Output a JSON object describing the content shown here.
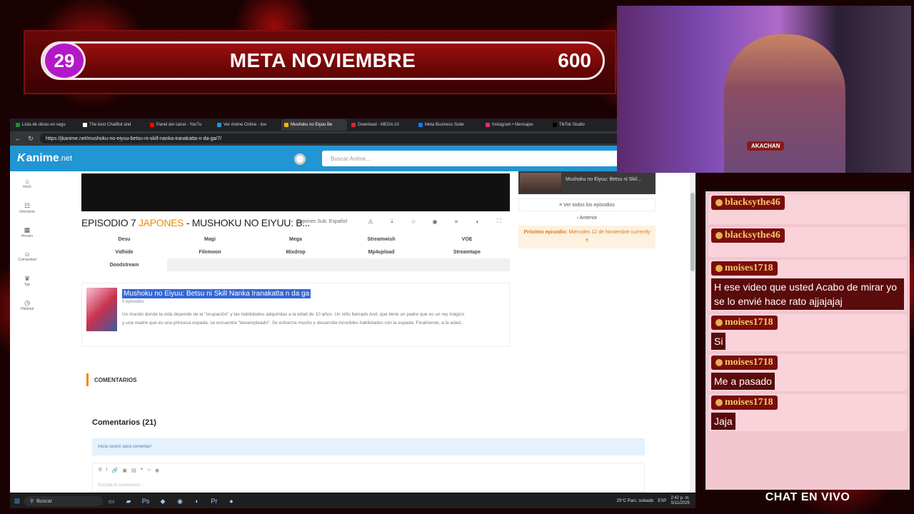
{
  "goal": {
    "current": "29",
    "title": "META NOVIEMBRE",
    "target": "600"
  },
  "browser": {
    "tabs": [
      {
        "label": "Lista de obras en segu",
        "color": "#1e8e3e"
      },
      {
        "label": "The best ChatBot and",
        "color": "#ffffff"
      },
      {
        "label": "Panel del canal - YouTu",
        "color": "#ff0000"
      },
      {
        "label": "Ver Anime Online - too",
        "color": "#2196d3"
      },
      {
        "label": "Mushoku no Eiyuu Be",
        "color": "#f5b400",
        "active": true
      },
      {
        "label": "Download - MEGA 10",
        "color": "#d9272e"
      },
      {
        "label": "Meta Business Suite",
        "color": "#1877f2"
      },
      {
        "label": "Instagram • Mensajes",
        "color": "#e1306c"
      },
      {
        "label": "TikTok Studio",
        "color": "#000000"
      }
    ],
    "url": "https://jkanime.net/mushoku-no-eiyuu-betsu-ni-skill-nanka-iranakatta-n-da-ga/7/"
  },
  "site": {
    "logo_k": "K",
    "logo_text": "anime",
    "logo_tld": ".net",
    "search_placeholder": "Buscar Anime...",
    "sidebar": [
      {
        "icon": "⌂",
        "label": "Inicio"
      },
      {
        "icon": "☷",
        "label": "Directorio"
      },
      {
        "icon": "▦",
        "label": "Horario"
      },
      {
        "icon": "☺",
        "label": "Comunidad"
      },
      {
        "icon": "♛",
        "label": "Top"
      },
      {
        "icon": "◷",
        "label": "Historial"
      }
    ],
    "episode": {
      "prefix": "EPISODIO 7 ",
      "lang": "JAPONES",
      "rest": " - MUSHOKU NO EIYUU: B..."
    },
    "language_select": "Japones Sub. Español",
    "tools": [
      "⚠",
      "⤓",
      "☆",
      "◉",
      "≡",
      "◐",
      "⛶"
    ],
    "servers": [
      [
        "Desu",
        "Magi",
        "Mega",
        "Streamwish",
        "VOE"
      ],
      [
        "Vidhide",
        "Filemoon",
        "Mixdrop",
        "Mp4upload",
        "Streamtape"
      ],
      [
        "Doodstream"
      ]
    ],
    "anime": {
      "name": "Mushoku no Eiyuu: Betsu ni Skill Nanka Iranakatta n da ga",
      "episodes": "0 episodios",
      "description": "Un mundo donde la vida depende de la \"ocupación\" y las habilidades adquiridas a la edad de 10 años. Un niño llamado Arel, que tiene un padre que es un rey mágico y una madre que es una princesa espada, se encuentra \"desempleado\". Se esfuerza mucho y desarrolla increíbles habilidades con la espada. Finalmente, a la edad..."
    },
    "right_panel": {
      "episode_label": "Mushoku no Eiyuu: Betsu ni Skil...",
      "all_episodes": "≡ Ver todos los episodios",
      "previous": "‹ Anterior",
      "next_label": "Próximo episodio:",
      "next_value": " Miercoles 12 de Noviembre currently 🕈"
    },
    "comments": {
      "header": "COMENTARIOS",
      "count": "Comentarios (21)",
      "login": "Inicia sesión para comentar!",
      "editor_tools": [
        "B",
        "I",
        "🔗",
        "▣",
        "▤",
        "❞",
        "‹›",
        "◉"
      ],
      "placeholder": "Escribe tu comentario..."
    }
  },
  "taskbar": {
    "search": "Buscar",
    "weather": "25°C  Parc. soleado",
    "lang": "ESP",
    "time": "2:42 p. m.",
    "date": "5/11/2025"
  },
  "webcam": {
    "badge": "AKACHAN"
  },
  "chat": {
    "footer": "CHAT EN VIVO",
    "messages": [
      {
        "user": "blacksythe46",
        "text": ""
      },
      {
        "user": "blacksythe46",
        "text": ""
      },
      {
        "user": "moises1718",
        "text": "H ese video que usted Acabo de mirar yo se lo envié hace rato ajjajajaj"
      },
      {
        "user": "moises1718",
        "text": "Si"
      },
      {
        "user": "moises1718",
        "text": "Me a pasado"
      },
      {
        "user": "moises1718",
        "text": "Jaja"
      }
    ]
  }
}
